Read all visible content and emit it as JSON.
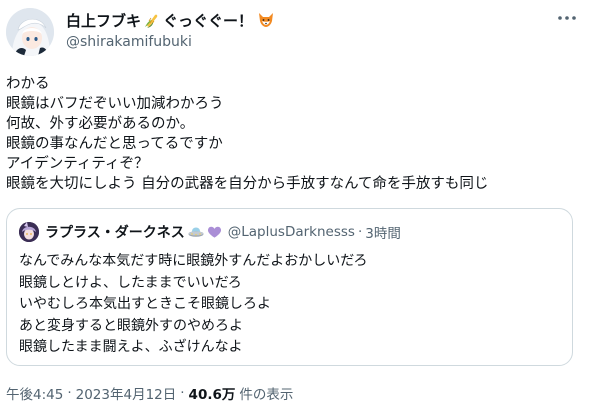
{
  "author": {
    "display_name": "白上フブキ",
    "name_suffix": "ぐっぐぐー！",
    "name_emojis": [
      "corn-emoji",
      "fox-emoji"
    ],
    "handle": "@shirakamifubuki"
  },
  "tweet": {
    "lines": [
      "わかる",
      "眼鏡はバフだぞいい加減わかろう",
      "何故、外す必要があるのか。",
      "眼鏡の事なんだと思ってるですか",
      "アイデンティティぞ？",
      "眼鏡を大切にしよう 自分の武器を自分から手放すなんて命を手放すも同じ"
    ]
  },
  "quote": {
    "display_name": "ラプラス・ダークネス",
    "name_emojis": [
      "ufo-emoji",
      "purple-heart-emoji"
    ],
    "handle": "@LaplusDarknesss",
    "separator": "·",
    "time": "3時間",
    "lines": [
      "なんでみんな本気だす時に眼鏡外すんだよおかしいだろ",
      "眼鏡しとけよ、したままでいいだろ",
      "いやむしろ本気出すときこそ眼鏡しろよ",
      "あと変身すると眼鏡外すのやめろよ",
      "眼鏡したまま闘えよ、ふざけんなよ"
    ]
  },
  "meta": {
    "time": "午後4:45",
    "separator": "·",
    "date": "2023年4月12日",
    "views_count": "40.6万",
    "views_label": "件の表示"
  },
  "colors": {
    "text_primary": "#0f1419",
    "text_secondary": "#536471",
    "border": "#cfd9de"
  }
}
